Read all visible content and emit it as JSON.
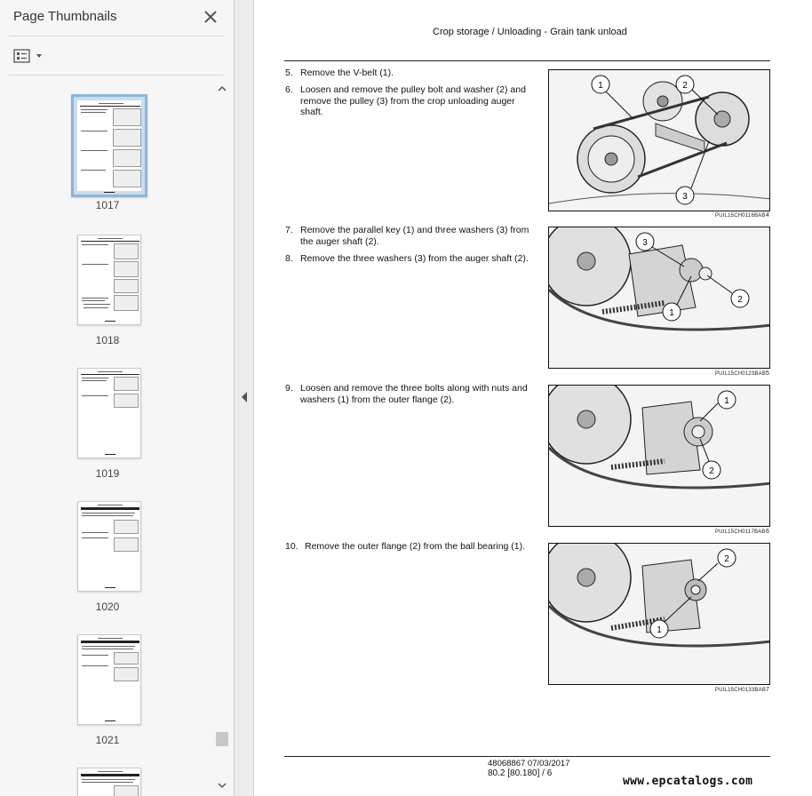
{
  "sidebar": {
    "title": "Page Thumbnails",
    "thumbnails": [
      {
        "label": "1017",
        "selected": true
      },
      {
        "label": "1018",
        "selected": false
      },
      {
        "label": "1019",
        "selected": false
      },
      {
        "label": "1020",
        "selected": false
      },
      {
        "label": "1021",
        "selected": false
      },
      {
        "label": "",
        "selected": false
      }
    ]
  },
  "document": {
    "header": "Crop storage / Unloading - Grain tank unload",
    "steps": [
      {
        "num": "5.",
        "text": "Remove the V-belt (1)."
      },
      {
        "num": "6.",
        "text": "Loosen and remove the pulley bolt and washer (2) and remove the pulley (3) from the crop unloading auger shaft."
      },
      {
        "num": "7.",
        "text": "Remove the parallel key (1) and three washers (3) from the auger shaft (2)."
      },
      {
        "num": "8.",
        "text": "Remove the three washers (3) from the auger shaft (2)."
      },
      {
        "num": "9.",
        "text": "Loosen and remove the three bolts along with nuts and washers (1) from the outer flange (2)."
      },
      {
        "num": "10.",
        "text": "Remove the outer flange (2) from the ball bearing (1)."
      }
    ],
    "figures": [
      {
        "code": "PUIL15CH0116BAB",
        "number": "4",
        "callouts": [
          "1",
          "2",
          "3"
        ]
      },
      {
        "code": "PUIL15CH0123BAB",
        "number": "5",
        "callouts": [
          "3",
          "1",
          "2"
        ]
      },
      {
        "code": "PUIL15CH0117BAB",
        "number": "6",
        "callouts": [
          "1",
          "2"
        ]
      },
      {
        "code": "PUIL15CH0133BAB",
        "number": "7",
        "callouts": [
          "2",
          "1"
        ]
      }
    ],
    "footer_doc": "48068867 07/03/2017",
    "footer_page": "80.2 [80.180] / 6",
    "watermark": "www.epcatalogs.com"
  }
}
